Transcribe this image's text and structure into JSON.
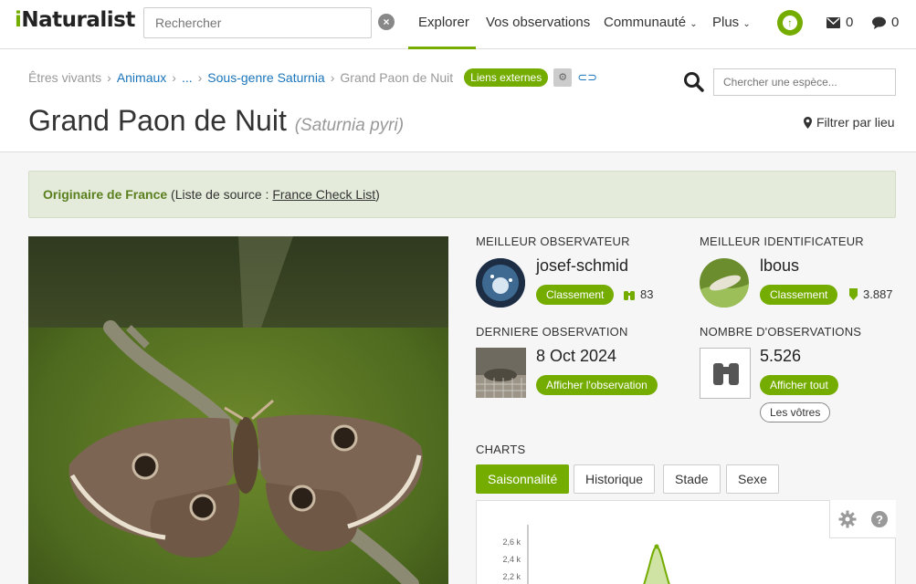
{
  "nav": {
    "logo_prefix": "i",
    "logo_rest": "Naturalist",
    "search_placeholder": "Rechercher",
    "links": [
      "Explorer",
      "Vos observations",
      "Communauté",
      "Plus"
    ],
    "messages_count": "0",
    "notifications_count": "0"
  },
  "breadcrumb": [
    "Êtres vivants",
    "Animaux",
    "...",
    "Sous-genre Saturnia",
    "Grand Paon de Nuit"
  ],
  "external_links_label": "Liens externes",
  "title": {
    "common_name": "Grand Paon de Nuit",
    "scientific_name": "(Saturnia pyri)"
  },
  "species_search_placeholder": "Chercher une espèce...",
  "filter_place_label": "Filtrer par lieu",
  "native_notice": {
    "bold": "Originaire de France",
    "middle": " (Liste de source : ",
    "link": "France Check List",
    "end": ")"
  },
  "top_observer": {
    "label": "MEILLEUR OBSERVATEUR",
    "name": "josef-schmid",
    "button": "Classement",
    "count": "83"
  },
  "top_identifier": {
    "label": "MEILLEUR IDENTIFICATEUR",
    "name": "lbous",
    "button": "Classement",
    "count": "3.887"
  },
  "last_observation": {
    "label": "DERNIERE OBSERVATION",
    "date": "8 Oct 2024",
    "button": "Afficher l'observation"
  },
  "observation_count": {
    "label": "NOMBRE D'OBSERVATIONS",
    "value": "5.526",
    "button": "Afficher tout",
    "button_outline": "Les vôtres"
  },
  "charts": {
    "label": "CHARTS",
    "tabs": [
      "Saisonnalité",
      "Historique",
      "Stade",
      "Sexe"
    ],
    "active_tab": 0,
    "y_ticks": [
      "2,6 k",
      "2,4 k",
      "2,2 k"
    ]
  },
  "colors": {
    "accent": "#74ac00",
    "link": "#1a75bc",
    "native_bg": "#e4ebda"
  }
}
